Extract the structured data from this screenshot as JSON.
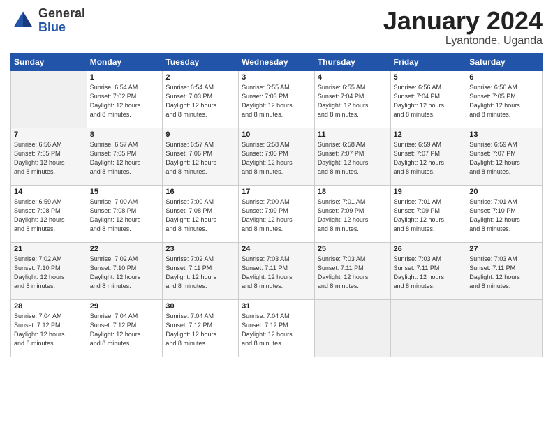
{
  "logo": {
    "general": "General",
    "blue": "Blue"
  },
  "title": "January 2024",
  "subtitle": "Lyantonde, Uganda",
  "days_header": [
    "Sunday",
    "Monday",
    "Tuesday",
    "Wednesday",
    "Thursday",
    "Friday",
    "Saturday"
  ],
  "weeks": [
    [
      {
        "day": "",
        "info": ""
      },
      {
        "day": "1",
        "info": "Sunrise: 6:54 AM\nSunset: 7:02 PM\nDaylight: 12 hours\nand 8 minutes."
      },
      {
        "day": "2",
        "info": "Sunrise: 6:54 AM\nSunset: 7:03 PM\nDaylight: 12 hours\nand 8 minutes."
      },
      {
        "day": "3",
        "info": "Sunrise: 6:55 AM\nSunset: 7:03 PM\nDaylight: 12 hours\nand 8 minutes."
      },
      {
        "day": "4",
        "info": "Sunrise: 6:55 AM\nSunset: 7:04 PM\nDaylight: 12 hours\nand 8 minutes."
      },
      {
        "day": "5",
        "info": "Sunrise: 6:56 AM\nSunset: 7:04 PM\nDaylight: 12 hours\nand 8 minutes."
      },
      {
        "day": "6",
        "info": "Sunrise: 6:56 AM\nSunset: 7:05 PM\nDaylight: 12 hours\nand 8 minutes."
      }
    ],
    [
      {
        "day": "7",
        "info": "Sunrise: 6:56 AM\nSunset: 7:05 PM\nDaylight: 12 hours\nand 8 minutes."
      },
      {
        "day": "8",
        "info": "Sunrise: 6:57 AM\nSunset: 7:05 PM\nDaylight: 12 hours\nand 8 minutes."
      },
      {
        "day": "9",
        "info": "Sunrise: 6:57 AM\nSunset: 7:06 PM\nDaylight: 12 hours\nand 8 minutes."
      },
      {
        "day": "10",
        "info": "Sunrise: 6:58 AM\nSunset: 7:06 PM\nDaylight: 12 hours\nand 8 minutes."
      },
      {
        "day": "11",
        "info": "Sunrise: 6:58 AM\nSunset: 7:07 PM\nDaylight: 12 hours\nand 8 minutes."
      },
      {
        "day": "12",
        "info": "Sunrise: 6:59 AM\nSunset: 7:07 PM\nDaylight: 12 hours\nand 8 minutes."
      },
      {
        "day": "13",
        "info": "Sunrise: 6:59 AM\nSunset: 7:07 PM\nDaylight: 12 hours\nand 8 minutes."
      }
    ],
    [
      {
        "day": "14",
        "info": "Sunrise: 6:59 AM\nSunset: 7:08 PM\nDaylight: 12 hours\nand 8 minutes."
      },
      {
        "day": "15",
        "info": "Sunrise: 7:00 AM\nSunset: 7:08 PM\nDaylight: 12 hours\nand 8 minutes."
      },
      {
        "day": "16",
        "info": "Sunrise: 7:00 AM\nSunset: 7:08 PM\nDaylight: 12 hours\nand 8 minutes."
      },
      {
        "day": "17",
        "info": "Sunrise: 7:00 AM\nSunset: 7:09 PM\nDaylight: 12 hours\nand 8 minutes."
      },
      {
        "day": "18",
        "info": "Sunrise: 7:01 AM\nSunset: 7:09 PM\nDaylight: 12 hours\nand 8 minutes."
      },
      {
        "day": "19",
        "info": "Sunrise: 7:01 AM\nSunset: 7:09 PM\nDaylight: 12 hours\nand 8 minutes."
      },
      {
        "day": "20",
        "info": "Sunrise: 7:01 AM\nSunset: 7:10 PM\nDaylight: 12 hours\nand 8 minutes."
      }
    ],
    [
      {
        "day": "21",
        "info": "Sunrise: 7:02 AM\nSunset: 7:10 PM\nDaylight: 12 hours\nand 8 minutes."
      },
      {
        "day": "22",
        "info": "Sunrise: 7:02 AM\nSunset: 7:10 PM\nDaylight: 12 hours\nand 8 minutes."
      },
      {
        "day": "23",
        "info": "Sunrise: 7:02 AM\nSunset: 7:11 PM\nDaylight: 12 hours\nand 8 minutes."
      },
      {
        "day": "24",
        "info": "Sunrise: 7:03 AM\nSunset: 7:11 PM\nDaylight: 12 hours\nand 8 minutes."
      },
      {
        "day": "25",
        "info": "Sunrise: 7:03 AM\nSunset: 7:11 PM\nDaylight: 12 hours\nand 8 minutes."
      },
      {
        "day": "26",
        "info": "Sunrise: 7:03 AM\nSunset: 7:11 PM\nDaylight: 12 hours\nand 8 minutes."
      },
      {
        "day": "27",
        "info": "Sunrise: 7:03 AM\nSunset: 7:11 PM\nDaylight: 12 hours\nand 8 minutes."
      }
    ],
    [
      {
        "day": "28",
        "info": "Sunrise: 7:04 AM\nSunset: 7:12 PM\nDaylight: 12 hours\nand 8 minutes."
      },
      {
        "day": "29",
        "info": "Sunrise: 7:04 AM\nSunset: 7:12 PM\nDaylight: 12 hours\nand 8 minutes."
      },
      {
        "day": "30",
        "info": "Sunrise: 7:04 AM\nSunset: 7:12 PM\nDaylight: 12 hours\nand 8 minutes."
      },
      {
        "day": "31",
        "info": "Sunrise: 7:04 AM\nSunset: 7:12 PM\nDaylight: 12 hours\nand 8 minutes."
      },
      {
        "day": "",
        "info": ""
      },
      {
        "day": "",
        "info": ""
      },
      {
        "day": "",
        "info": ""
      }
    ]
  ]
}
